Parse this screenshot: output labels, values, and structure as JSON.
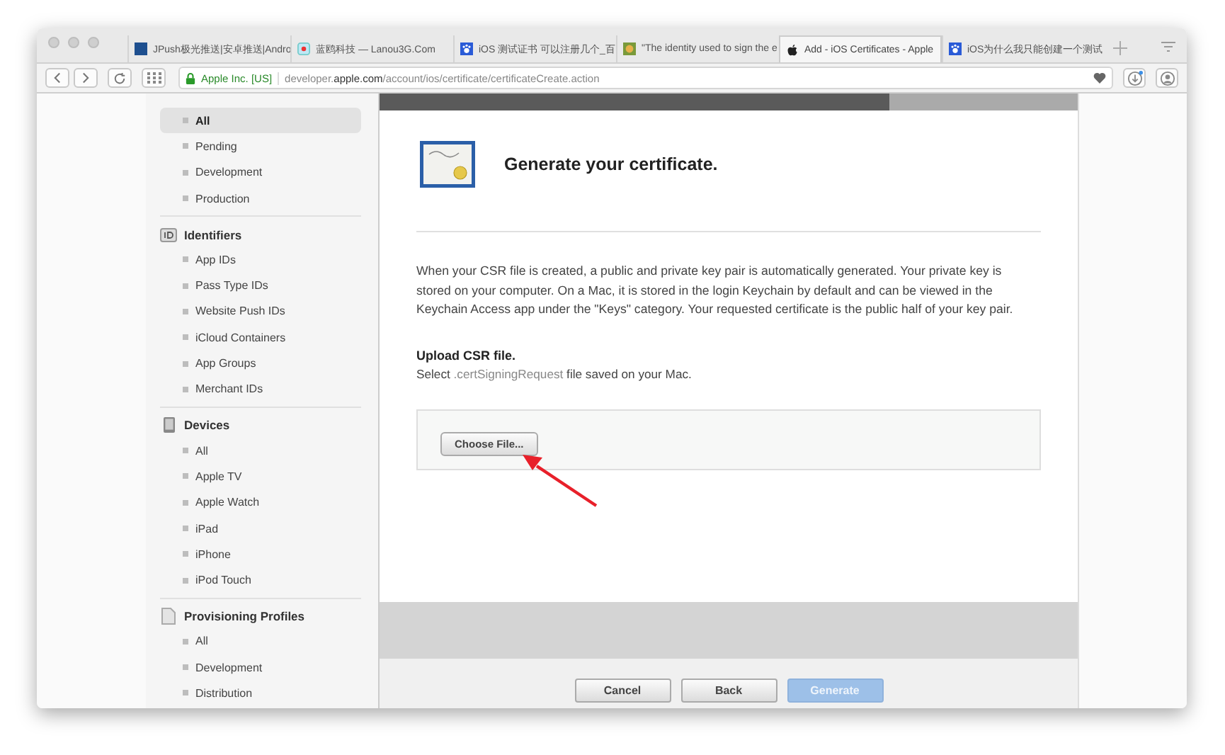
{
  "browser": {
    "tabs": [
      {
        "title": "JPush极光推送|安卓推送|Andro",
        "kind": "letter",
        "selected": false
      },
      {
        "title": "蓝鸥科技 — Lanou3G.Com",
        "kind": "ring",
        "selected": false
      },
      {
        "title": "iOS 测试证书 可以注册几个_百",
        "kind": "paw",
        "selected": false
      },
      {
        "title": "\"The identity used to sign the e",
        "kind": "photo",
        "selected": false
      },
      {
        "title": "Add - iOS Certificates - Apple",
        "kind": "apple",
        "selected": true
      },
      {
        "title": "iOS为什么我只能创建一个测试",
        "kind": "paw",
        "selected": false
      }
    ],
    "address": {
      "organization": "Apple Inc. [US]",
      "url_prefix": "developer.",
      "url_domain": "apple.com",
      "url_path": "/account/ios/certificate/certificateCreate.action"
    }
  },
  "sidebar": {
    "sections": [
      {
        "items": [
          {
            "label": "All",
            "selected": true
          },
          {
            "label": "Pending",
            "selected": false
          },
          {
            "label": "Development",
            "selected": false
          },
          {
            "label": "Production",
            "selected": false
          }
        ]
      },
      {
        "kind": "identifiers",
        "heading": "Identifiers",
        "items": [
          {
            "label": "App IDs",
            "selected": false
          },
          {
            "label": "Pass Type IDs",
            "selected": false
          },
          {
            "label": "Website Push IDs",
            "selected": false
          },
          {
            "label": "iCloud Containers",
            "selected": false
          },
          {
            "label": "App Groups",
            "selected": false
          },
          {
            "label": "Merchant IDs",
            "selected": false
          }
        ]
      },
      {
        "kind": "devices",
        "heading": "Devices",
        "items": [
          {
            "label": "All",
            "selected": false
          },
          {
            "label": "Apple TV",
            "selected": false
          },
          {
            "label": "Apple Watch",
            "selected": false
          },
          {
            "label": "iPad",
            "selected": false
          },
          {
            "label": "iPhone",
            "selected": false
          },
          {
            "label": "iPod Touch",
            "selected": false
          }
        ]
      },
      {
        "kind": "profiles",
        "heading": "Provisioning Profiles",
        "items": [
          {
            "label": "All",
            "selected": false
          },
          {
            "label": "Development",
            "selected": false
          },
          {
            "label": "Distribution",
            "selected": false
          }
        ]
      }
    ]
  },
  "main": {
    "title": "Generate your certificate.",
    "paragraph": "When your CSR file is created, a public and private key pair is automatically generated. Your private key is stored on your computer. On a Mac, it is stored in the login Keychain by default and can be viewed in the Keychain Access app under the \"Keys\" category. Your requested certificate is the public half of your key pair.",
    "upload_heading": "Upload CSR file.",
    "upload_hint": {
      "before": "Select ",
      "highlight": ".certSigningRequest",
      "after": " file saved on your Mac."
    },
    "file_button": "Choose File...",
    "buttons": [
      {
        "label": "Cancel",
        "kind": "normal",
        "disabled": false
      },
      {
        "label": "Back",
        "kind": "normal",
        "disabled": false
      },
      {
        "label": "Generate",
        "kind": "primary",
        "disabled": true
      }
    ]
  }
}
